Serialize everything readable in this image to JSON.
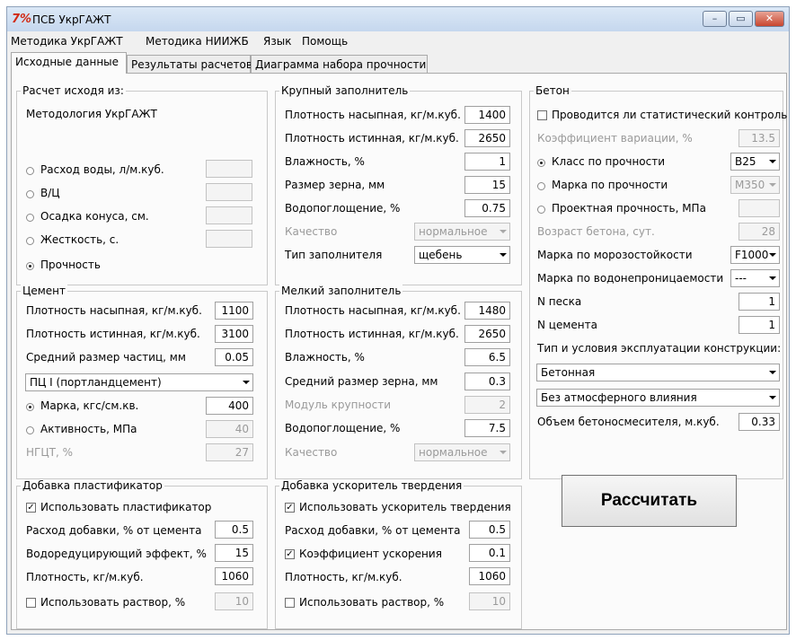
{
  "window": {
    "icon": "7%",
    "title": "ПСБ УкрГАЖТ"
  },
  "menu": [
    "Методика УкрГАЖТ",
    "Методика НИИЖБ",
    "Язык",
    "Помощь"
  ],
  "tabs": [
    "Исходные данные",
    "Результаты расчетов",
    "Диаграмма набора прочности"
  ],
  "calc_basis": {
    "title": "Расчет исходя из:",
    "method": "Методология УкрГАЖТ",
    "options": [
      {
        "label": "Расход воды, л/м.куб.",
        "value": ""
      },
      {
        "label": "В/Ц",
        "value": ""
      },
      {
        "label": "Осадка конуса, см.",
        "value": ""
      },
      {
        "label": "Жесткость, с.",
        "value": ""
      },
      {
        "label": "Прочность"
      }
    ]
  },
  "cement": {
    "title": "Цемент",
    "bulk_density_label": "Плотность насыпная, кг/м.куб.",
    "bulk_density": "1100",
    "true_density_label": "Плотность истинная, кг/м.куб.",
    "true_density": "3100",
    "particle_size_label": "Средний размер частиц, мм",
    "particle_size": "0.05",
    "type": "ПЦ I (портландцемент)",
    "grade_label": "Марка, кгс/см.кв.",
    "grade": "400",
    "activity_label": "Активность, МПа",
    "activity": "40",
    "ngct_label": "НГЦТ, %",
    "ngct": "27"
  },
  "coarse": {
    "title": "Крупный заполнитель",
    "bulk_density_label": "Плотность насыпная, кг/м.куб.",
    "bulk_density": "1400",
    "true_density_label": "Плотность истинная, кг/м.куб.",
    "true_density": "2650",
    "moisture_label": "Влажность, %",
    "moisture": "1",
    "grain_label": "Размер зерна, мм",
    "grain": "15",
    "absorption_label": "Водопоглощение, %",
    "absorption": "0.75",
    "quality_label": "Качество",
    "quality": "нормальное",
    "type_label": "Тип заполнителя",
    "type": "щебень"
  },
  "fine": {
    "title": "Мелкий заполнитель",
    "bulk_density_label": "Плотность насыпная, кг/м.куб.",
    "bulk_density": "1480",
    "true_density_label": "Плотность истинная, кг/м.куб.",
    "true_density": "2650",
    "moisture_label": "Влажность, %",
    "moisture": "6.5",
    "grain_label": "Средний размер зерна, мм",
    "grain": "0.3",
    "modulus_label": "Модуль крупности",
    "modulus": "2",
    "absorption_label": "Водопоглощение, %",
    "absorption": "7.5",
    "quality_label": "Качество",
    "quality": "нормальное"
  },
  "concrete": {
    "title": "Бетон",
    "stat_control_label": "Проводится ли статистический контроль",
    "variation_label": "Коэффициент вариации, %",
    "variation": "13.5",
    "class_label": "Класс по прочности",
    "class_value": "B25",
    "mark_label": "Марка по прочности",
    "mark_value": "M350",
    "design_label": "Проектная прочность, МПа",
    "design_value": "",
    "age_label": "Возраст бетона, сут.",
    "age": "28",
    "frost_label": "Марка по морозостойкости",
    "frost": "F1000",
    "water_label": "Марка по водонепроницаемости",
    "water": "---",
    "sand_n_label": "N песка",
    "sand_n": "1",
    "cement_n_label": "N цемента",
    "cement_n": "1",
    "exploitation_label": "Тип и условия эксплуатации конструкции:",
    "structure_type": "Бетонная",
    "atmosphere": "Без атмосферного влияния",
    "mixer_label": "Объем бетоносмесителя, м.куб.",
    "mixer": "0.33"
  },
  "plasticizer": {
    "title": "Добавка пластификатор",
    "use_label": "Использовать пластификатор",
    "dose_label": "Расход добавки, % от цемента",
    "dose": "0.5",
    "effect_label": "Водоредуцирующий эффект, %",
    "effect": "15",
    "density_label": "Плотность, кг/м.куб.",
    "density": "1060",
    "solution_label": "Использовать раствор, %",
    "solution": "10"
  },
  "accelerator": {
    "title": "Добавка ускоритель твердения",
    "use_label": "Использовать ускоритель твердения",
    "dose_label": "Расход добавки, % от цемента",
    "dose": "0.5",
    "coef_label": "Коэффициент ускорения",
    "coef": "0.1",
    "density_label": "Плотность, кг/м.куб.",
    "density": "1060",
    "solution_label": "Использовать раствор, %",
    "solution": "10"
  },
  "calculate_label": "Рассчитать",
  "icons": {
    "minimize": "–",
    "maximize": "▭",
    "close": "✕",
    "check": "✓"
  }
}
